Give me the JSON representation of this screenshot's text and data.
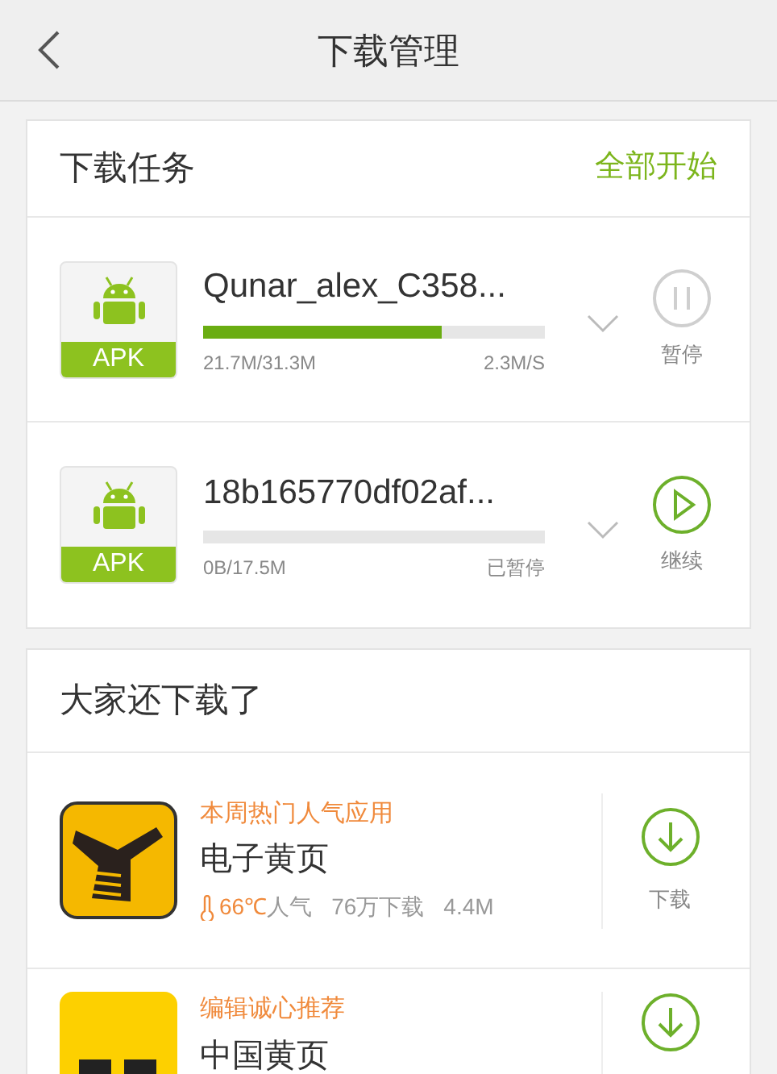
{
  "header": {
    "title": "下载管理"
  },
  "tasks_section": {
    "title": "下载任务",
    "action": "全部开始"
  },
  "tasks": [
    {
      "name": "Qunar_alex_C358...",
      "badge": "APK",
      "level": 0.7,
      "size": "21.7M/31.3M",
      "status": "2.3M/S",
      "paused": false,
      "button": "暂停"
    },
    {
      "name": "18b165770df02af...",
      "badge": "APK",
      "level": 0,
      "size": "0B/17.5M",
      "status": "已暂停",
      "paused": true,
      "button": "继续"
    }
  ],
  "recommend_section": {
    "title": "大家还下载了"
  },
  "apps": [
    {
      "kind": "book",
      "tag": "本周热门人气应用",
      "name": "电子黄页",
      "heat": "66℃",
      "heat_label": "人气",
      "downloads": "76万下载",
      "size": "4.4M",
      "button": "下载"
    },
    {
      "kind": "plain",
      "tag": "编辑诚心推荐",
      "name": "中国黄页"
    }
  ]
}
